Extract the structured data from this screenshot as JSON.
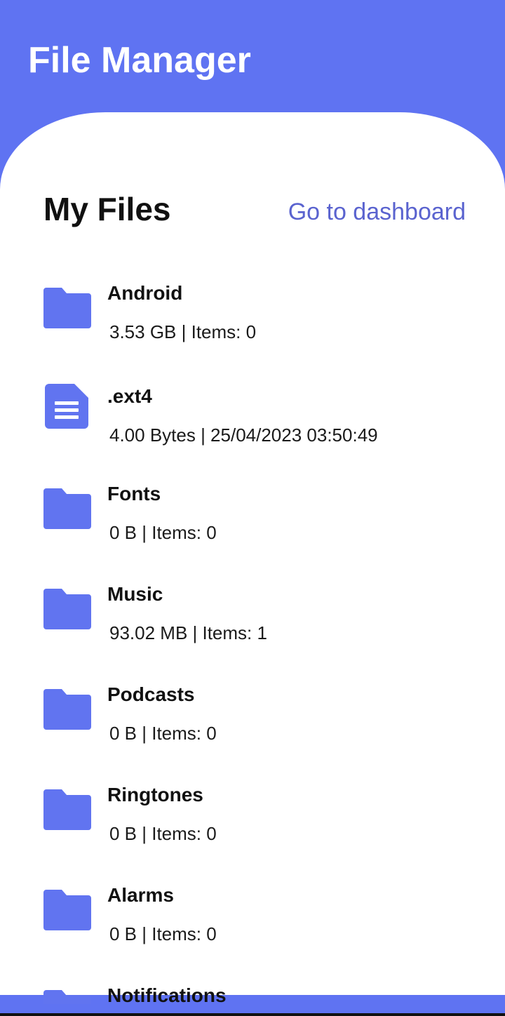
{
  "app": {
    "title": "File Manager"
  },
  "section": {
    "title": "My Files",
    "dashboard_link": "Go to dashboard"
  },
  "colors": {
    "header": "#5f73f2",
    "icon": "#6174f0",
    "link": "#5a63cf"
  },
  "items": [
    {
      "name": "Android",
      "meta": "3.53 GB | Items: 0",
      "icon": "folder-icon"
    },
    {
      "name": ".ext4",
      "meta": "4.00 Bytes | 25/04/2023 03:50:49",
      "icon": "file-icon"
    },
    {
      "name": "Fonts",
      "meta": "0 B | Items: 0",
      "icon": "folder-icon"
    },
    {
      "name": "Music",
      "meta": "93.02 MB | Items: 1",
      "icon": "folder-icon"
    },
    {
      "name": "Podcasts",
      "meta": "0 B | Items: 0",
      "icon": "folder-icon"
    },
    {
      "name": "Ringtones",
      "meta": "0 B | Items: 0",
      "icon": "folder-icon"
    },
    {
      "name": "Alarms",
      "meta": "0 B | Items: 0",
      "icon": "folder-icon"
    },
    {
      "name": "Notifications",
      "meta": "",
      "icon": "folder-icon"
    }
  ]
}
